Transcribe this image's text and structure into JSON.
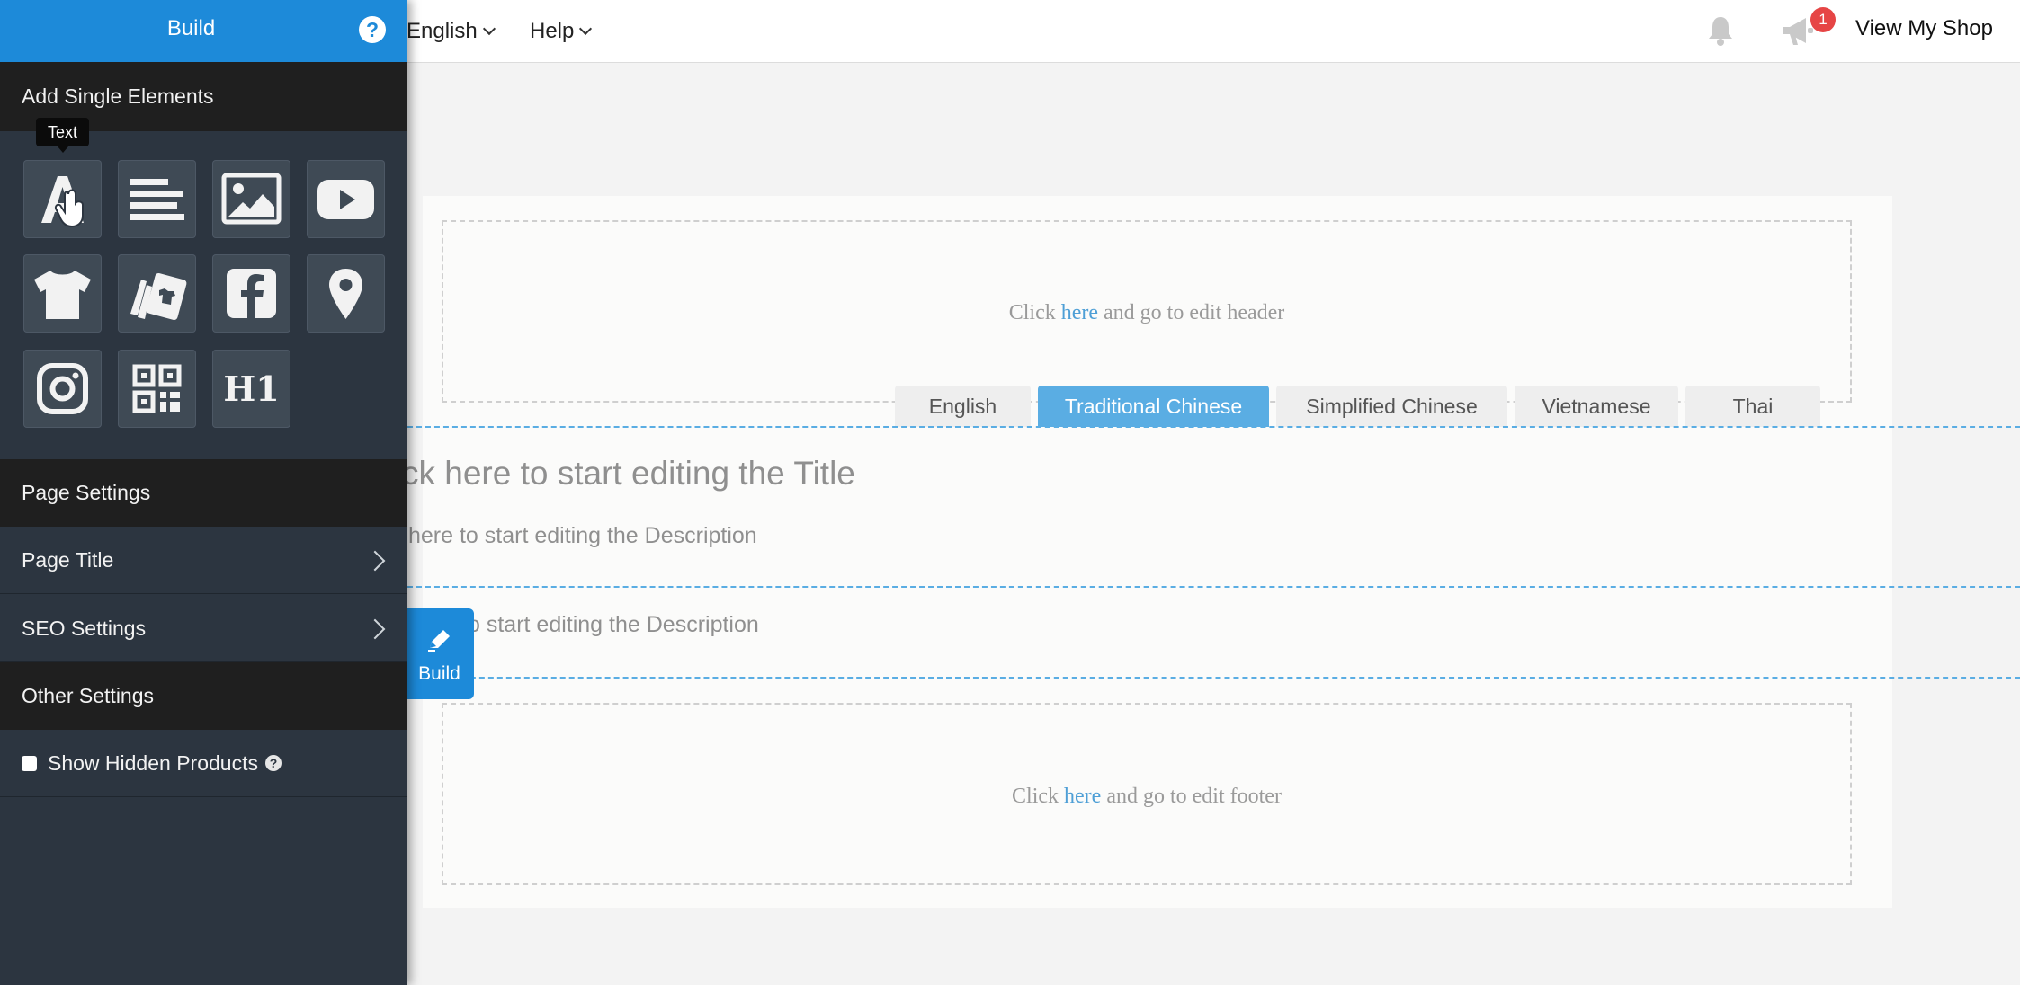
{
  "topbar": {
    "language_menu": "English",
    "help_menu": "Help",
    "notification_badge": "1",
    "view_shop_label": "View My Shop"
  },
  "panel": {
    "title": "Build",
    "help_icon_label": "?",
    "add_elements_heading": "Add Single Elements",
    "tooltip": "Text",
    "elements": [
      {
        "icon": "text-element-icon"
      },
      {
        "icon": "paragraph-element-icon"
      },
      {
        "icon": "image-element-icon"
      },
      {
        "icon": "video-element-icon"
      },
      {
        "icon": "product-element-icon"
      },
      {
        "icon": "product-cards-element-icon"
      },
      {
        "icon": "facebook-element-icon"
      },
      {
        "icon": "map-pin-element-icon"
      },
      {
        "icon": "instagram-element-icon"
      },
      {
        "icon": "qr-code-element-icon"
      },
      {
        "icon": "heading-element-icon",
        "label": "H1"
      }
    ],
    "page_settings_heading": "Page Settings",
    "page_title_label": "Page Title",
    "seo_settings_label": "SEO Settings",
    "other_settings_heading": "Other Settings",
    "show_hidden_products_label": "Show Hidden Products",
    "show_hidden_products_checked": false
  },
  "canvas": {
    "header_note_before": "Click ",
    "header_note_link": "here",
    "header_note_after": " and go to edit header",
    "footer_note_before": "Click ",
    "footer_note_link": "here",
    "footer_note_after": " and go to edit footer",
    "language_tabs": [
      "English",
      "Traditional Chinese",
      "Simplified Chinese",
      "Vietnamese",
      "Thai"
    ],
    "active_tab": "Traditional Chinese",
    "title_placeholder": "ck here to start editing the Title",
    "description_placeholder_1": "here to start editing the Description",
    "description_placeholder_2": "o start editing the Description",
    "floating_build_label": "Build"
  },
  "colors": {
    "accent": "#1d8ad9",
    "tab_active": "#5aade3",
    "panel_bg": "#2c3540",
    "section_header_bg": "#1f1f1f",
    "badge": "#e64545"
  }
}
